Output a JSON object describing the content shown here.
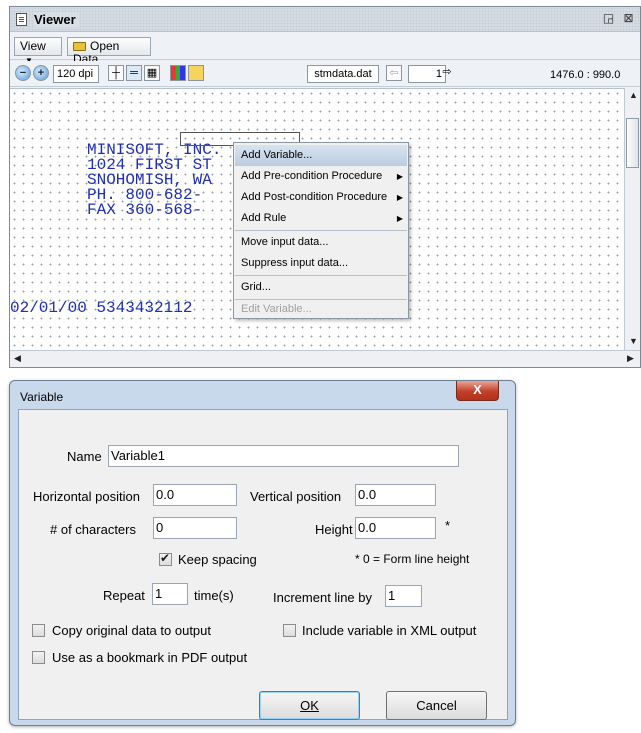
{
  "viewer": {
    "title": "Viewer",
    "menu": {
      "view_label": "View",
      "open_data_label": "Open Data"
    },
    "toolbar": {
      "dpi_value": "120 dpi",
      "data_file": "stmdata.dat",
      "page_value": "1",
      "coordinates": "1476.0 : 990.0"
    },
    "document_lines": [
      "MINISOFT, INC.",
      "1024 FIRST ST",
      "SNOHOMISH, WA",
      "PH. 800-682-",
      "FAX 360-568-"
    ],
    "document_data_line": "02/01/00 5343432112"
  },
  "context_menu": {
    "items": [
      {
        "label": "Add Variable..."
      },
      {
        "label": "Add Pre-condition Procedure"
      },
      {
        "label": "Add Post-condition Procedure"
      },
      {
        "label": "Add Rule"
      },
      {
        "label": "Move input data..."
      },
      {
        "label": "Suppress input data..."
      },
      {
        "label": "Grid..."
      },
      {
        "label": "Edit Variable..."
      }
    ]
  },
  "dialog": {
    "title": "Variable",
    "close_glyph": "X",
    "name_label": "Name",
    "name_value": "Variable1",
    "hpos_label": "Horizontal position",
    "hpos_value": "0.0",
    "vpos_label": "Vertical position",
    "vpos_value": "0.0",
    "chars_label": "# of characters",
    "chars_value": "0",
    "height_label": "Height",
    "height_value": "0.0",
    "height_star": "*",
    "keep_spacing_label": "Keep spacing",
    "keep_spacing_checked": true,
    "height_note": "* 0 = Form line height",
    "repeat_label": "Repeat",
    "repeat_value": "1",
    "times_label": "time(s)",
    "increment_label": "Increment line by",
    "increment_value": "1",
    "copy_label": "Copy original data to output",
    "xml_label": "Include variable in XML output",
    "bookmark_label": "Use as a bookmark in PDF output",
    "ok_label": "OK",
    "cancel_label": "Cancel"
  }
}
